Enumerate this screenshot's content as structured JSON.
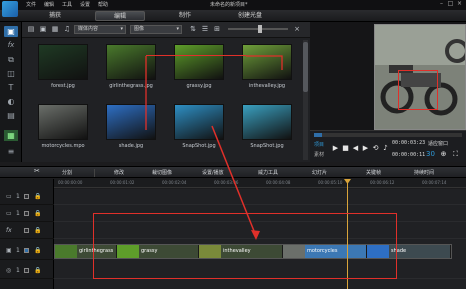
{
  "menubar": {
    "items": [
      "文件",
      "编辑",
      "工具",
      "设置",
      "帮助"
    ],
    "title": "未命名的新项目*"
  },
  "modebar": {
    "tabs": [
      "捕获",
      "编辑",
      "制作",
      "创建光盘"
    ],
    "active": "编辑"
  },
  "library": {
    "filter": "媒体内容",
    "sort": "图像",
    "items": [
      {
        "label": "forest.jpg",
        "color": "#1f3a24"
      },
      {
        "label": "girlinthegrass.jpg",
        "color": "#4a7a2c"
      },
      {
        "label": "grassy.jpg",
        "color": "#5e9e2a"
      },
      {
        "label": "inthevalley.jpg",
        "color": "#6fa03a"
      },
      {
        "label": "motorcycles.mpo",
        "color": "#6b6f6a"
      },
      {
        "label": "shade.jpg",
        "color": "#2e6fc4"
      },
      {
        "label": "SnapShot.jpg",
        "color": "#2e8fc4"
      },
      {
        "label": "SnapShot.jpg",
        "color": "#3aa0c0"
      }
    ]
  },
  "preview": {
    "mode_project": "项目",
    "mode_clip": "素材",
    "timecode": "00:00:03:23",
    "timecode2": "00:00:00:11",
    "zoom": "适应窗口",
    "zoom_value": "30"
  },
  "timeline_toolbar": {
    "buttons": [
      "分割",
      "修改",
      "裁切图像",
      "设置/播放",
      "威力工具",
      "幻灯片",
      "关键帧",
      "持续时间"
    ]
  },
  "ruler": {
    "ticks": [
      "00:00:00:00",
      "00:00:01:02",
      "00:00:02:04",
      "00:00:03:06",
      "00:00:04:08",
      "00:00:05:10",
      "00:00:06:12",
      "00:00:07:14"
    ]
  },
  "tracks": [
    {
      "num": "1",
      "icon": "video-icon"
    },
    {
      "num": "1",
      "icon": "overlay-icon"
    },
    {
      "num": "1",
      "icon": "fx-icon"
    },
    {
      "num": "1",
      "icon": "title-icon"
    },
    {
      "num": "1",
      "icon": "voice-icon"
    },
    {
      "num": "1",
      "icon": "music-icon"
    }
  ],
  "clips": [
    {
      "label": "girlinthegrass",
      "color": "#4a7a2c"
    },
    {
      "label": "grassy",
      "color": "#5e9e2a"
    },
    {
      "label": "inthevalley",
      "color": "#7a8a3a"
    },
    {
      "label": "motorcycles",
      "color": "#6b6f6a"
    },
    {
      "label": "shade",
      "color": "#2e6fc4"
    }
  ],
  "colors": {
    "accent": "#2f6ea8",
    "annotation_red": "#e0302a",
    "playhead": "#d9a43a"
  }
}
